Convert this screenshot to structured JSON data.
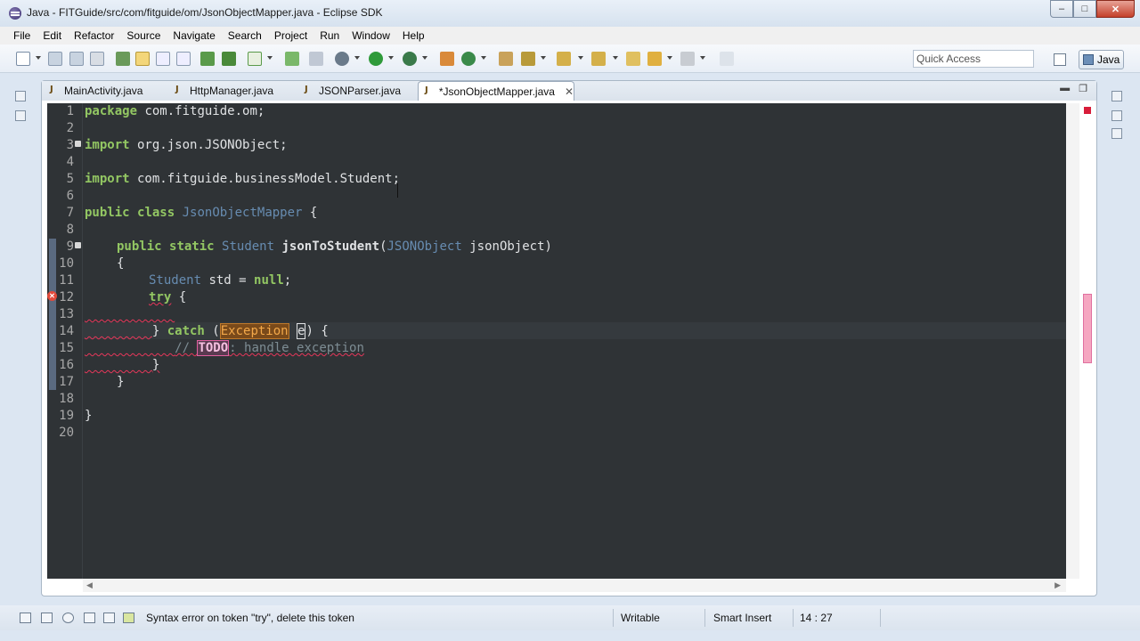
{
  "window": {
    "title": "Java - FITGuide/src/com/fitguide/om/JsonObjectMapper.java - Eclipse SDK",
    "minimize": "–",
    "maximize": "□",
    "close": "✕"
  },
  "menu": [
    "File",
    "Edit",
    "Refactor",
    "Source",
    "Navigate",
    "Search",
    "Project",
    "Run",
    "Window",
    "Help"
  ],
  "toolbar": {
    "quick_access_placeholder": "Quick Access",
    "perspective_label": "Java"
  },
  "tabs": [
    {
      "label": "MainActivity.java",
      "active": false
    },
    {
      "label": "HttpManager.java",
      "active": false
    },
    {
      "label": "JSONParser.java",
      "active": false
    },
    {
      "label": "*JsonObjectMapper.java",
      "active": true,
      "close": "✕"
    }
  ],
  "editor": {
    "line_numbers": [
      "1",
      "2",
      "3",
      "4",
      "5",
      "6",
      "7",
      "8",
      "9",
      "10",
      "11",
      "12",
      "13",
      "14",
      "15",
      "16",
      "17",
      "18",
      "19",
      "20"
    ],
    "current_line": 14,
    "error_line": 12
  },
  "code": {
    "l1_kw": "package",
    "l1_rest": " com.fitguide.om;",
    "l3_kw": "import",
    "l3_rest": " org.json.JSONObject;",
    "l5_kw": "import",
    "l5_rest": " com.fitguide.businessModel.Student;",
    "l7_kw1": "public",
    "l7_kw2": "class",
    "l7_cls": "JsonObjectMapper",
    "l7_rest": " {",
    "l9_kw1": "public",
    "l9_kw2": "static",
    "l9_type": "Student",
    "l9_method": "jsonToStudent",
    "l9_open": "(",
    "l9_ptype": "JSONObject",
    "l9_param": " jsonObject)",
    "l10": "{",
    "l11_type": "Student",
    "l11_mid": " std = ",
    "l11_null": "null",
    "l11_end": ";",
    "l12_try": "try",
    "l12_rest": " {",
    "l14_open": "} ",
    "l14_catch": "catch",
    "l14_paren": " (",
    "l14_exc": "Exception",
    "l14_sp": " ",
    "l14_e": "e",
    "l14_end": ") {",
    "l15_slashes": "// ",
    "l15_todo": "TODO",
    "l15_rest": ": handle exception",
    "l16": "}",
    "l17": "}",
    "l19": "}"
  },
  "status": {
    "message": "Syntax error on token \"try\", delete this token",
    "writable": "Writable",
    "insert_mode": "Smart Insert",
    "position": "14 : 27"
  },
  "colors": {
    "editor_bg": "#2f3336",
    "keyword": "#93c763",
    "class_name": "#678cb1",
    "comment": "#7d8c93",
    "error": "#e8365a"
  }
}
